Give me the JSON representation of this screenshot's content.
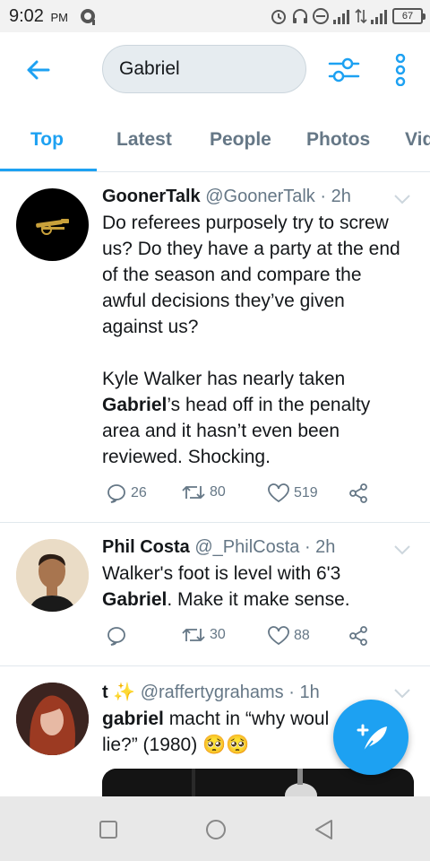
{
  "status_bar": {
    "time": "9:02",
    "ampm": "PM",
    "battery": "67"
  },
  "search": {
    "query": "Gabriel"
  },
  "tabs": [
    {
      "label": "Top",
      "active": true
    },
    {
      "label": "Latest"
    },
    {
      "label": "People"
    },
    {
      "label": "Photos"
    },
    {
      "label": "Vid"
    }
  ],
  "tweets": [
    {
      "name": "GoonerTalk",
      "handle": "@GoonerTalk",
      "time": "· 2h",
      "text_1": "Do referees purposely try to screw us? Do they have a party at the end of the season and compare the awful decisions they’ve given against us?",
      "text_2a": "Kyle Walker has nearly taken ",
      "text_2b": "Gabriel",
      "text_2c": "’s head off in the penalty area and it hasn’t even been reviewed. Shocking.",
      "replies": "26",
      "retweets": "80",
      "likes": "519"
    },
    {
      "name": "Phil Costa",
      "handle": "@_PhilCosta",
      "time": "· 2h",
      "text_a": "Walker's foot is level with 6'3 ",
      "text_b": "Gabriel",
      "text_c": ". Make it make sense.",
      "retweets": "30",
      "likes": "88"
    },
    {
      "name": "t ✨",
      "handle": "@raffertygrahams",
      "time": "· 1h",
      "text_a": "gabriel",
      "text_b": " macht in “why woul",
      "text_c": "lie?” (1980) 🥺🥺"
    }
  ],
  "colors": {
    "accent": "#1da1f2",
    "secondary_text": "#657786"
  },
  "icons": {
    "back": "arrow-left-icon",
    "filter": "sliders-icon",
    "more": "vertical-dots-icon",
    "reply": "speech-bubble-icon",
    "retweet": "retweet-icon",
    "like": "heart-icon",
    "share": "share-icon",
    "compose": "feather-plus-icon"
  }
}
